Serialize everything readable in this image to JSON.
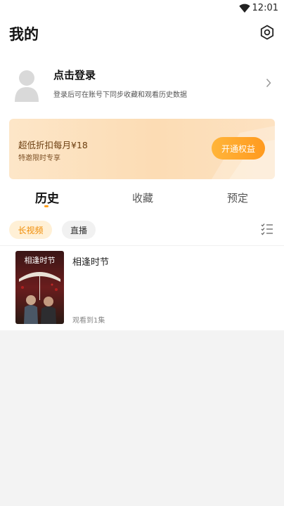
{
  "status": {
    "time": "12:01"
  },
  "header": {
    "title": "我的"
  },
  "profile": {
    "login": "点击登录",
    "desc": "登录后可在账号下同步收藏和观看历史数据"
  },
  "vip": {
    "title": "超低折扣每月¥18",
    "subtitle": "特邀限时专享",
    "button": "开通权益"
  },
  "tabs": [
    {
      "label": "历史"
    },
    {
      "label": "收藏"
    },
    {
      "label": "预定"
    }
  ],
  "filters": [
    {
      "label": "长视频"
    },
    {
      "label": "直播"
    }
  ],
  "history": [
    {
      "title": "相逢时节",
      "progress": "观看到1集",
      "poster_text": "相逢时节"
    }
  ],
  "colors": {
    "accent": "#ff9f1c",
    "vip_bg": "#fde2c2"
  }
}
